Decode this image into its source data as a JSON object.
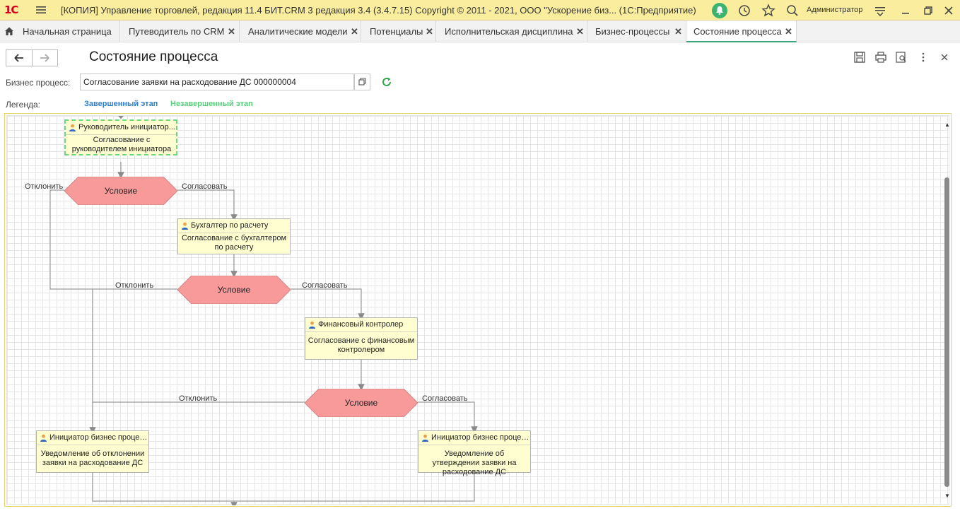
{
  "titlebar": {
    "logo": "1С",
    "title": "[КОПИЯ] Управление торговлей, редакция 11.4 БИТ.CRM 3 редакция 3.4 (3.4.7.15) Copyright © 2011 - 2021, ООО \"Ускорение биз...  (1С:Предприятие)",
    "user": "Администратор"
  },
  "tabs": [
    {
      "label": "Начальная страница"
    },
    {
      "label": "Путеводитель по CRM"
    },
    {
      "label": "Аналитические модели"
    },
    {
      "label": "Потенциалы"
    },
    {
      "label": "Исполнительская дисциплина"
    },
    {
      "label": "Бизнес-процессы"
    },
    {
      "label": "Состояние процесса"
    }
  ],
  "form": {
    "title": "Состояние процесса",
    "bp_label": "Бизнес процесс:",
    "bp_value": "Согласование заявки на расходование ДС 000000004",
    "legend_label": "Легенда:",
    "legend_done": "Завершенный этап",
    "legend_undone": "Незавершенный этап"
  },
  "diagram": {
    "tasks": [
      {
        "head": "Руководитель инициатор...",
        "body": "Согласование с руководителем инициатора",
        "status": "undone"
      },
      {
        "head": "Бухгалтер по расчету",
        "body": "Согласование с бухгалтером по расчету",
        "status": "normal"
      },
      {
        "head": "Финансовый контролер",
        "body": "Согласование с финансовым контролером",
        "status": "normal"
      },
      {
        "head": "Инициатор бизнес процес...",
        "body": "Уведомление об отклонении заявки на расходование ДС",
        "status": "normal"
      },
      {
        "head": "Инициатор бизнес процес...",
        "body": "Уведомление об утверждении заявки на расходование ДС",
        "status": "normal"
      }
    ],
    "conditions": [
      {
        "label": "Условие"
      },
      {
        "label": "Условие"
      },
      {
        "label": "Условие"
      }
    ],
    "edge_labels": {
      "reject": "Отклонить",
      "approve": "Согласовать"
    }
  },
  "colors": {
    "titlebar_bg": "#fbed9e",
    "condition_fill": "#f8999a",
    "task_fill": "#fffed0",
    "done": "#2d7fd0",
    "undone": "#58d07b",
    "active_tab": "#3aa37a"
  }
}
